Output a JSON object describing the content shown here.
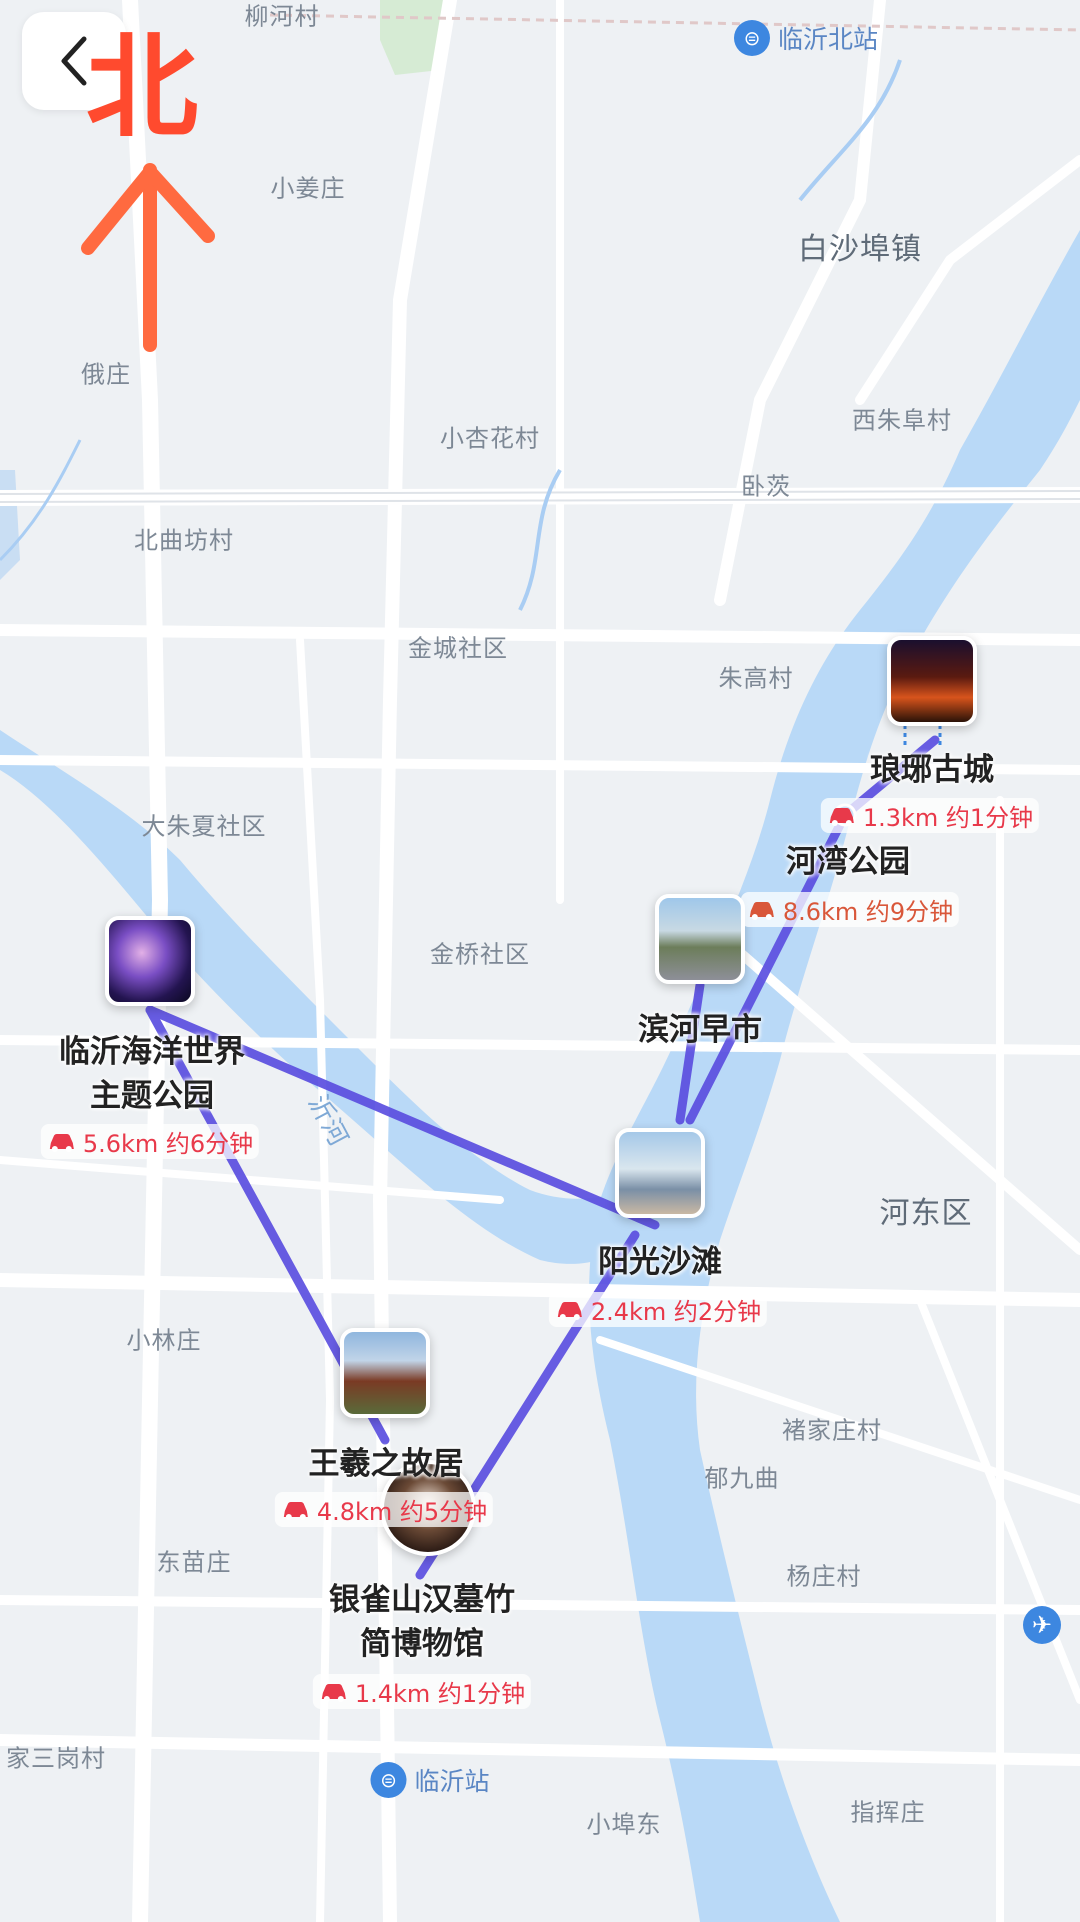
{
  "map": {
    "compass_label": "北",
    "back_icon": "chevron-left-icon",
    "river_label": "沂河",
    "places": [
      {
        "name": "柳河村"
      },
      {
        "name": "小姜庄"
      },
      {
        "name": "白沙埠镇"
      },
      {
        "name": "俄庄"
      },
      {
        "name": "小杏花村"
      },
      {
        "name": "西朱阜村"
      },
      {
        "name": "卧茨"
      },
      {
        "name": "北曲坊村"
      },
      {
        "name": "金城社区"
      },
      {
        "name": "朱高村"
      },
      {
        "name": "大朱夏社区"
      },
      {
        "name": "金桥社区"
      },
      {
        "name": "河东区"
      },
      {
        "name": "小林庄"
      },
      {
        "name": "褚家庄村"
      },
      {
        "name": "郁九曲"
      },
      {
        "name": "东苗庄"
      },
      {
        "name": "杨庄村"
      },
      {
        "name": "家三岗村"
      },
      {
        "name": "小埠东"
      },
      {
        "name": "指挥庄"
      }
    ],
    "stations": [
      {
        "name": "临沂北站",
        "icon": "train-station-icon"
      },
      {
        "name": "临沂站",
        "icon": "train-station-icon"
      }
    ],
    "airport_icon": "airplane-icon",
    "stops": [
      {
        "name": "琅琊古城",
        "leg": "1.3km 约1分钟",
        "leg_color": "#e8394a"
      },
      {
        "name": "河湾公园",
        "leg": "8.6km 约9分钟",
        "leg_color": "#d9573a"
      },
      {
        "name": "滨河早市",
        "leg": ""
      },
      {
        "name": "临沂海洋世界\n主题公园",
        "leg": "5.6km 约6分钟",
        "leg_color": "#e8394a"
      },
      {
        "name": "阳光沙滩",
        "leg": "2.4km 约2分钟",
        "leg_color": "#e8394a"
      },
      {
        "name": "王羲之故居",
        "leg": "4.8km 约5分钟",
        "leg_color": "#e8394a"
      },
      {
        "name": "银雀山汉墓竹\n简博物馆",
        "leg": "1.4km 约1分钟",
        "leg_color": "#e8394a"
      }
    ],
    "route_color": "#5b4fe0",
    "water_color": "#b9d9f7",
    "road_color": "#ffffff"
  }
}
